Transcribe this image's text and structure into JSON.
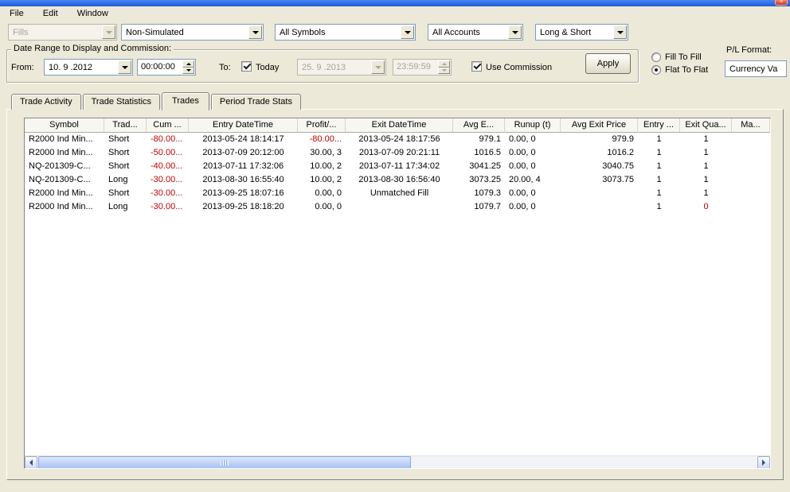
{
  "colors": {
    "negative": "#c00000",
    "window_border": "#1e5ad6"
  },
  "menu": {
    "items": [
      "File",
      "Edit",
      "Window"
    ]
  },
  "toolbar": {
    "fills": {
      "value": "Fills",
      "disabled": true
    },
    "mode": "Non-Simulated",
    "symbols": "All Symbols",
    "accounts": "All Accounts",
    "direction": "Long & Short"
  },
  "date_range": {
    "group_label": "Date Range to Display and Commission:",
    "from_label": "From:",
    "from_date": "10. 9 .2012",
    "from_time": "00:00:00",
    "to_label": "To:",
    "today_checkbox": {
      "label": "Today",
      "checked": true
    },
    "to_date": "25. 9 .2013",
    "to_time": "23:59:59",
    "use_commission_checkbox": {
      "label": "Use Commission",
      "checked": true
    },
    "apply_button": "Apply"
  },
  "pl_settings": {
    "fill_to_fill": {
      "label": "Fill To Fill",
      "selected": false
    },
    "flat_to_flat": {
      "label": "Flat To Flat",
      "selected": true
    },
    "format_label": "P/L Format:",
    "format_value": "Currency Va"
  },
  "tabs": {
    "items": [
      "Trade Activity",
      "Trade Statistics",
      "Trades",
      "Period Trade Stats"
    ],
    "active": "Trades"
  },
  "trades_table": {
    "columns": [
      "Symbol",
      "Trad...",
      "Cum ...",
      "Entry DateTime",
      "Profit/...",
      "Exit DateTime",
      "Avg E...",
      "Runup (t)",
      "Avg Exit Price",
      "Entry ...",
      "Exit Qua...",
      "Ma..."
    ],
    "rows": [
      {
        "cells": [
          "R2000 Ind Min...",
          "Short",
          "-80.00...",
          "2013-05-24 18:14:17",
          "-80.00...",
          "2013-05-24 18:17:56",
          "979.1",
          "0.00, 0",
          "979.9",
          "1",
          "1",
          ""
        ],
        "red": [
          2,
          4
        ]
      },
      {
        "cells": [
          "R2000 Ind Min...",
          "Short",
          "-50.00...",
          "2013-07-09 20:12:00",
          "30.00, 3",
          "2013-07-09 20:21:11",
          "1016.5",
          "0.00, 0",
          "1016.2",
          "1",
          "1",
          ""
        ],
        "red": [
          2
        ]
      },
      {
        "cells": [
          "NQ-201309-C...",
          "Short",
          "-40.00...",
          "2013-07-11 17:32:06",
          "10.00, 2",
          "2013-07-11 17:34:02",
          "3041.25",
          "0.00, 0",
          "3040.75",
          "1",
          "1",
          ""
        ],
        "red": [
          2
        ]
      },
      {
        "cells": [
          "NQ-201309-C...",
          "Long",
          "-30.00...",
          "2013-08-30 16:55:40",
          "10.00, 2",
          "2013-08-30 16:56:40",
          "3073.25",
          "20.00, 4",
          "3073.75",
          "1",
          "1",
          ""
        ],
        "red": [
          2
        ]
      },
      {
        "cells": [
          "R2000 Ind Min...",
          "Short",
          "-30.00...",
          "2013-09-25 18:07:16",
          "0.00, 0",
          "Unmatched Fill",
          "1079.3",
          "0.00, 0",
          "",
          "1",
          "1",
          ""
        ],
        "red": [
          2
        ]
      },
      {
        "cells": [
          "R2000 Ind Min...",
          "Long",
          "-30.00...",
          "2013-09-25 18:18:20",
          "0.00, 0",
          "",
          "1079.7",
          "0.00, 0",
          "",
          "1",
          "0",
          ""
        ],
        "red": [
          2,
          10
        ]
      }
    ]
  }
}
